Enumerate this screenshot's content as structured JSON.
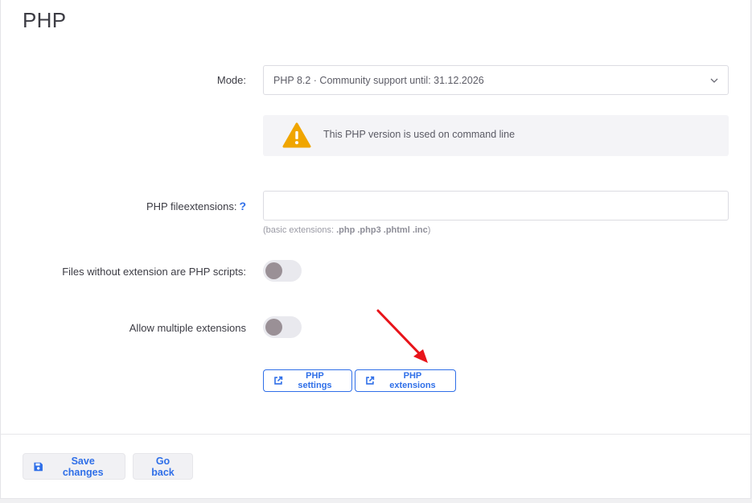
{
  "page": {
    "title": "PHP"
  },
  "mode": {
    "label": "Mode:",
    "value": "PHP 8.2 · Community support until: 31.12.2026",
    "icon": "chevron-down-icon"
  },
  "alert": {
    "icon": "warning-icon",
    "text": "This PHP version is used on command line",
    "color": "#f0a500"
  },
  "fileextensions": {
    "label": "PHP fileextensions:",
    "help": "?",
    "value": "",
    "placeholder": "",
    "hint_prefix": "(basic extensions: ",
    "hint_extensions": ".php .php3 .phtml .inc",
    "hint_suffix": ")"
  },
  "toggles": {
    "no_extension": {
      "label": "Files without extension are PHP scripts:",
      "on": false
    },
    "multiple": {
      "label": "Allow multiple extensions",
      "on": false
    }
  },
  "links": {
    "php_settings": {
      "label": "PHP settings",
      "icon": "external-link-icon"
    },
    "php_extensions": {
      "label": "PHP extensions",
      "icon": "external-link-icon"
    }
  },
  "annotation": {
    "icon": "red-arrow-icon",
    "color": "#e8141a"
  },
  "footer": {
    "save_label": "Save changes",
    "save_icon": "floppy-disk-icon",
    "back_label": "Go back"
  },
  "colors": {
    "accent": "#2f6fe8"
  }
}
